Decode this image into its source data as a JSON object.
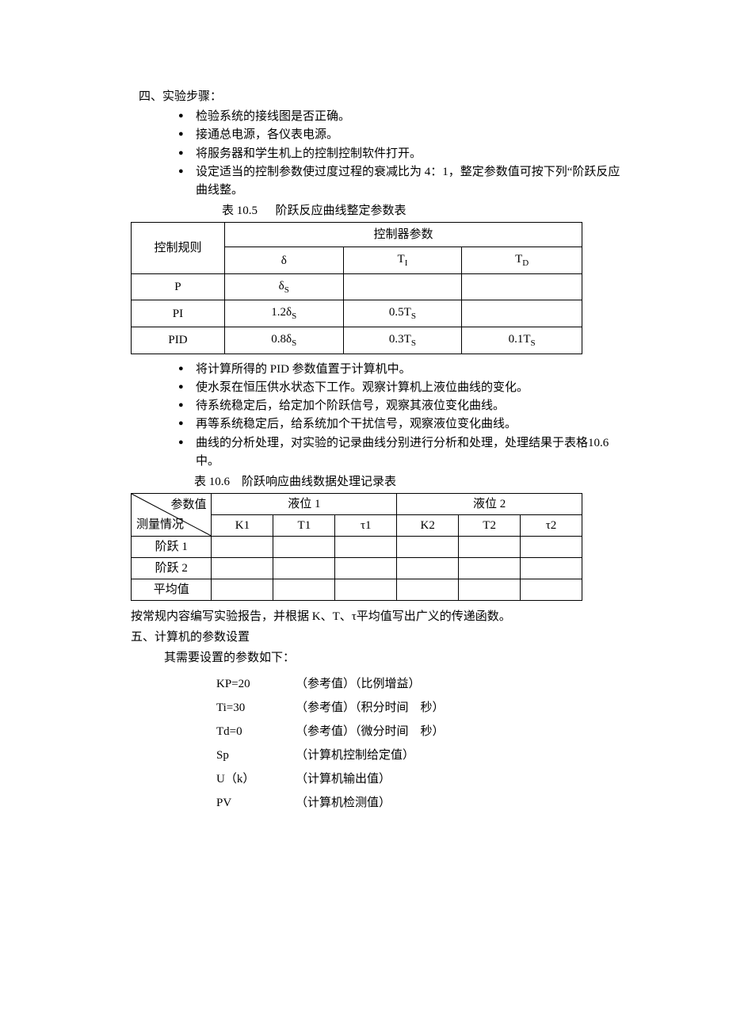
{
  "section4": {
    "title": "四、实验步骤：",
    "items": [
      "检验系统的接线图是否正确。",
      "接通总电源，各仪表电源。",
      "将服务器和学生机上的控制控制软件打开。",
      "设定适当的控制参数使过度过程的衰减比为 4：1，整定参数值可按下列“阶跃反应曲线整。"
    ]
  },
  "table1": {
    "caption_prefix": "表 10.5",
    "caption_text": "阶跃反应曲线整定参数表",
    "header_rule": "控制规则",
    "header_params": "控制器参数",
    "sub_delta": "δ",
    "sub_ti_base": "T",
    "sub_ti_sub": "I",
    "sub_td_base": "T",
    "sub_td_sub": "D",
    "rows": [
      {
        "rule": "P",
        "delta_pre": "",
        "delta_base": "δ",
        "delta_sub": "S",
        "ti_pre": "",
        "ti_base": "",
        "ti_sub": "",
        "td_pre": "",
        "td_base": "",
        "td_sub": ""
      },
      {
        "rule": "PI",
        "delta_pre": "1.2",
        "delta_base": "δ",
        "delta_sub": "S",
        "ti_pre": "0.5",
        "ti_base": "T",
        "ti_sub": "S",
        "td_pre": "",
        "td_base": "",
        "td_sub": ""
      },
      {
        "rule": "PID",
        "delta_pre": "0.8",
        "delta_base": "δ",
        "delta_sub": "S",
        "ti_pre": "0.3",
        "ti_base": "T",
        "ti_sub": "S",
        "td_pre": "0.1",
        "td_base": "T",
        "td_sub": "S"
      }
    ]
  },
  "section4b": {
    "items": [
      "将计算所得的 PID 参数值置于计算机中。",
      "使水泵在恒压供水状态下工作。观察计算机上液位曲线的变化。",
      "待系统稳定后，给定加个阶跃信号，观察其液位变化曲线。",
      "再等系统稳定后，给系统加个干扰信号，观察液位变化曲线。",
      "曲线的分析处理，对实验的记录曲线分别进行分析和处理，处理结果于表格10.6 中。"
    ]
  },
  "table2": {
    "caption_prefix": "表 10.6",
    "caption_text": "阶跃响应曲线数据处理记录表",
    "diag_top": "参数值",
    "diag_bottom": "测量情况",
    "col_group1": "液位 1",
    "col_group2": "液位 2",
    "cols": [
      "K1",
      "T1",
      "τ1",
      "K2",
      "T2",
      "τ2"
    ],
    "row_labels": [
      "阶跃 1",
      "阶跃 2",
      "平均值"
    ]
  },
  "after_table2": "按常规内容编写实验报告，并根据 K、T、τ平均值写出广义的传递函数。",
  "section5": {
    "title": "五、计算机的参数设置",
    "intro": "其需要设置的参数如下：",
    "params": [
      {
        "key": "KP=20",
        "desc": "（参考值）（比例增益）"
      },
      {
        "key": "Ti=30",
        "desc": "（参考值）（积分时间　秒）"
      },
      {
        "key": "Td=0",
        "desc": "（参考值）（微分时间　秒）"
      },
      {
        "key": "Sp",
        "desc": "（计算机控制给定值）"
      },
      {
        "key": "U（k）",
        "desc": "（计算机输出值）"
      },
      {
        "key": "PV",
        "desc": "（计算机检测值）"
      }
    ]
  }
}
